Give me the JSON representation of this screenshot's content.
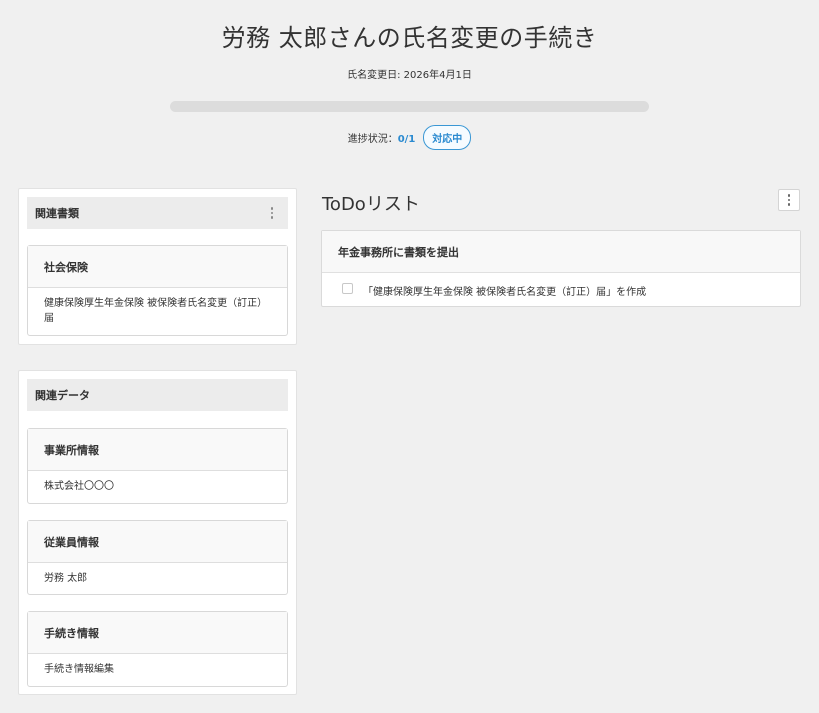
{
  "header": {
    "title": "労務 太郎さんの氏名変更の手続き",
    "change_date": "氏名変更日: 2026年4月1日"
  },
  "progress": {
    "label": "進捗状況：",
    "count": "0/1",
    "fraction": 0,
    "status_badge": "対応中"
  },
  "related_documents": {
    "title": "関連書類",
    "cards": [
      {
        "title": "社会保険",
        "body": "健康保険厚生年金保険 被保険者氏名変更（訂正）届"
      }
    ]
  },
  "related_data": {
    "title": "関連データ",
    "cards": [
      {
        "title": "事業所情報",
        "body": "株式会社〇〇〇"
      },
      {
        "title": "従業員情報",
        "body": "労務 太郎"
      },
      {
        "title": "手続き情報",
        "body": "手続き情報編集"
      }
    ]
  },
  "todo": {
    "title": "ToDoリスト",
    "groups": [
      {
        "title": "年金事務所に書類を提出",
        "items": [
          {
            "label": "「健康保険厚生年金保険 被保険者氏名変更（訂正）届」を作成",
            "checked": false
          }
        ]
      }
    ]
  },
  "colors": {
    "accent": "#2a8ad0",
    "background": "#f0f0f0"
  }
}
